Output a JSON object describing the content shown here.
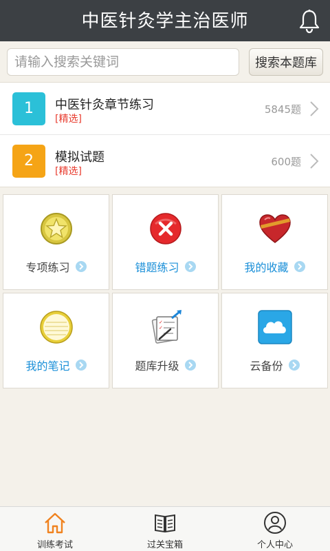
{
  "header": {
    "title": "中医针灸学主治医师",
    "icon": "bell-icon"
  },
  "search": {
    "placeholder": "请输入搜索关键词",
    "value": "",
    "button_label": "搜索本题库"
  },
  "chapters": [
    {
      "number": "1",
      "name": "中医针灸章节练习",
      "tag": "[精选]",
      "count": "5845题",
      "color": "#2bc0d8"
    },
    {
      "number": "2",
      "name": "模拟试题",
      "tag": "[精选]",
      "count": "600题",
      "color": "#f5a416"
    }
  ],
  "features": [
    {
      "label": "专项练习",
      "icon": "star-medal-icon",
      "color": "gray"
    },
    {
      "label": "错题练习",
      "icon": "wrong-x-icon",
      "color": "blue"
    },
    {
      "label": "我的收藏",
      "icon": "heart-favorite-icon",
      "color": "blue"
    },
    {
      "label": "我的笔记",
      "icon": "notebook-icon",
      "color": "blue"
    },
    {
      "label": "题库升级",
      "icon": "upgrade-checklist-icon",
      "color": "gray"
    },
    {
      "label": "云备份",
      "icon": "cloud-icon",
      "color": "gray"
    }
  ],
  "tabs": [
    {
      "label": "训练考试",
      "icon": "home-icon",
      "active": true
    },
    {
      "label": "过关宝箱",
      "icon": "book-icon",
      "active": false
    },
    {
      "label": "个人中心",
      "icon": "user-icon",
      "active": false
    }
  ],
  "colors": {
    "accent_blue": "#1a8fd8",
    "tag_red": "#e83b2e",
    "titlebar": "#3c4044",
    "active_tab": "#f0821e"
  }
}
